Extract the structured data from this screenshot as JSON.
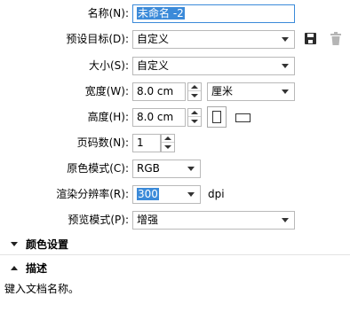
{
  "form": {
    "name_label": "名称(N):",
    "name_value": "未命名 -2",
    "preset_label": "预设目标(D):",
    "preset_value": "自定义",
    "size_label": "大小(S):",
    "size_value": "自定义",
    "width_label": "宽度(W):",
    "width_value": "8.0 cm",
    "unit_value": "厘米",
    "height_label": "高度(H):",
    "height_value": "8.0 cm",
    "pages_label": "页码数(N):",
    "pages_value": "1",
    "color_mode_label": "原色模式(C):",
    "color_mode_value": "RGB",
    "resolution_label": "渲染分辨率(R):",
    "resolution_value": "300",
    "resolution_unit": "dpi",
    "preview_label": "预览模式(P):",
    "preview_value": "增强"
  },
  "sections": {
    "color_settings": "颜色设置",
    "description": "描述",
    "description_text": "键入文档名称。"
  },
  "icons": {
    "save": "save-icon",
    "delete": "trash-icon",
    "portrait": "portrait-orientation-icon",
    "landscape": "landscape-orientation-icon"
  },
  "colors": {
    "focus_border": "#3b8ad9",
    "selection": "#3b8ad9"
  }
}
